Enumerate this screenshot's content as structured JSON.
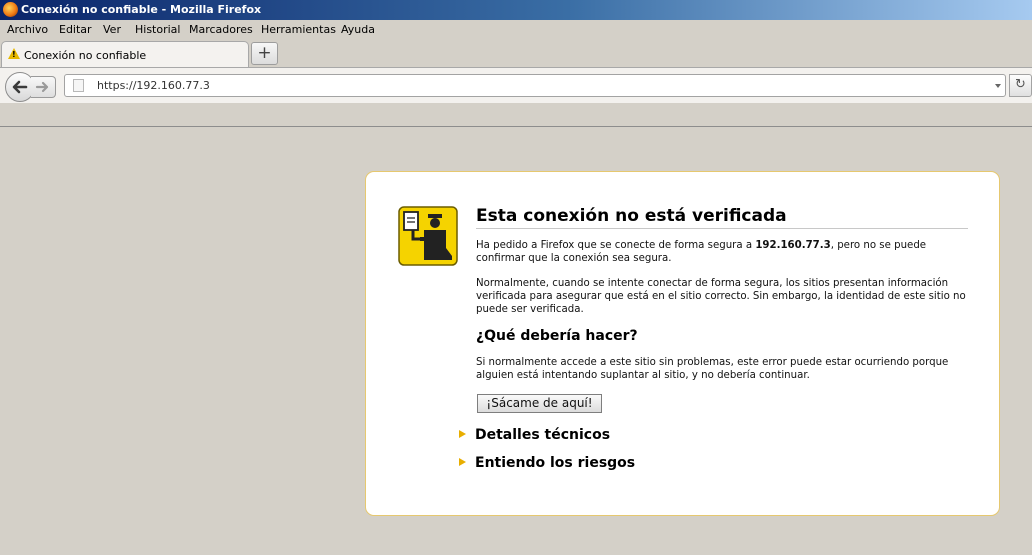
{
  "window": {
    "title": "Conexión no confiable - Mozilla Firefox",
    "app_icon": "firefox-icon"
  },
  "menu": {
    "items": [
      "Archivo",
      "Editar",
      "Ver",
      "Historial",
      "Marcadores",
      "Herramientas",
      "Ayuda"
    ]
  },
  "tabs": [
    {
      "label": "Conexión no confiable",
      "icon": "warning-icon"
    }
  ],
  "new_tab_label": "+",
  "address_bar": {
    "url": "https://192.160.77.3"
  },
  "error_page": {
    "title": "Esta conexión no está verificada",
    "para1_prefix": "Ha pedido a Firefox que se conecte de forma segura a ",
    "para1_host": "192.160.77.3",
    "para1_suffix": ", pero no se puede confirmar que la conexión sea segura.",
    "para2": "Normalmente, cuando se intente conectar de forma segura, los sitios presentan información verificada para asegurar que está en el sitio correcto. Sin embargo, la identidad de este sitio no puede ser verificada.",
    "what_heading": "¿Qué debería hacer?",
    "para3": "Si normalmente accede a este sitio sin problemas, este error puede estar ocurriendo porque alguien está intentando suplantar al sitio, y no debería continuar.",
    "get_out_button": "¡Sácame de aquí!",
    "technical_details": "Detalles técnicos",
    "understand_risks": "Entiendo los riesgos"
  },
  "colors": {
    "accent_yellow": "#e8ae00",
    "border": "#e6c86f",
    "titlebar": "#0a246a",
    "chrome": "#d4d0c8"
  }
}
